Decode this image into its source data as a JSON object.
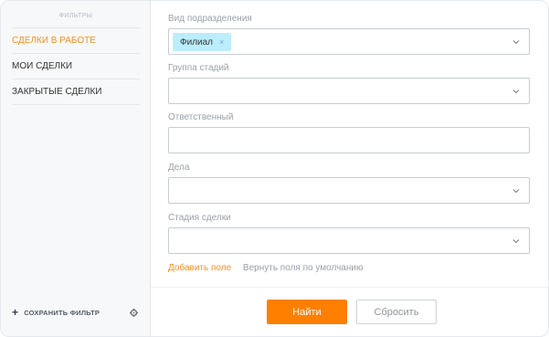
{
  "sidebar": {
    "header": "ФИЛЬТРЫ",
    "presets": [
      {
        "label": "СДЕЛКИ В РАБОТЕ",
        "active": true
      },
      {
        "label": "МОИ СДЕЛКИ",
        "active": false
      },
      {
        "label": "ЗАКРЫТЫЕ СДЕЛКИ",
        "active": false
      }
    ],
    "save_filter": "СОХРАНИТЬ ФИЛЬТР"
  },
  "fields": {
    "division": {
      "label": "Вид подразделения",
      "tag": "Филиал"
    },
    "stage_group": {
      "label": "Группа стадий",
      "value": ""
    },
    "responsible": {
      "label": "Ответственный",
      "value": ""
    },
    "tasks": {
      "label": "Дела",
      "value": ""
    },
    "deal_stage": {
      "label": "Стадия сделки",
      "value": ""
    }
  },
  "links": {
    "add_field": "Добавить поле",
    "restore_defaults": "Вернуть поля по умолчанию"
  },
  "buttons": {
    "find": "Найти",
    "reset": "Сбросить"
  },
  "colors": {
    "accent": "#f7901e",
    "primary_button": "#ff7f00",
    "tag_bg": "#bcedfc"
  }
}
